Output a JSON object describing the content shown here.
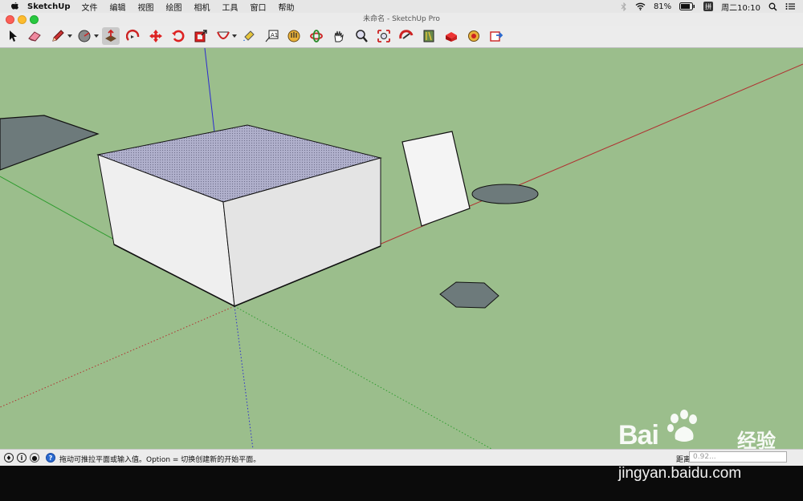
{
  "menubar": {
    "app_name": "SketchUp",
    "items": [
      "文件",
      "编辑",
      "视图",
      "绘图",
      "相机",
      "工具",
      "窗口",
      "帮助"
    ],
    "battery": "81%",
    "input_method": "拼",
    "clock": "周二10:10"
  },
  "window": {
    "title": "未命名 - SketchUp Pro"
  },
  "toolbar": {
    "tools": [
      "select-tool",
      "eraser-tool",
      "pencil-line-tool",
      "circle-tool",
      "push-pull-tool",
      "follow-me-tool",
      "move-tool",
      "rotate-tool",
      "scale-tool",
      "arc-tool",
      "paint-bucket-tool",
      "text-tool",
      "interact-tool",
      "orbit-tool",
      "pan-tool",
      "zoom-tool",
      "zoom-extents-tool",
      "3d-warehouse-tool",
      "extension-warehouse-tool",
      "layout-tool",
      "send-to-layout-tool",
      "extension-tool",
      "share-model-tool"
    ],
    "active_tool": "push-pull-tool"
  },
  "statusbar": {
    "hint": "拖动可推拉平面或输入值。Option = 切换创建新的开始平面。",
    "measure_label": "距离",
    "measure_value": "0.92..."
  },
  "watermark": {
    "brand": "Bai",
    "brand_suffix": "经验",
    "url": "jingyan.baidu.com"
  },
  "colors": {
    "canvas_bg": "#9bbe8c",
    "red_axis": "#b03030",
    "green_axis": "#2e9c2e",
    "blue_axis": "#2a2ad0",
    "shadow_face": "#6d7a7b",
    "box_front": "#eeeeee",
    "box_side": "#e2e2e2",
    "box_top": "#a8a8c4"
  }
}
